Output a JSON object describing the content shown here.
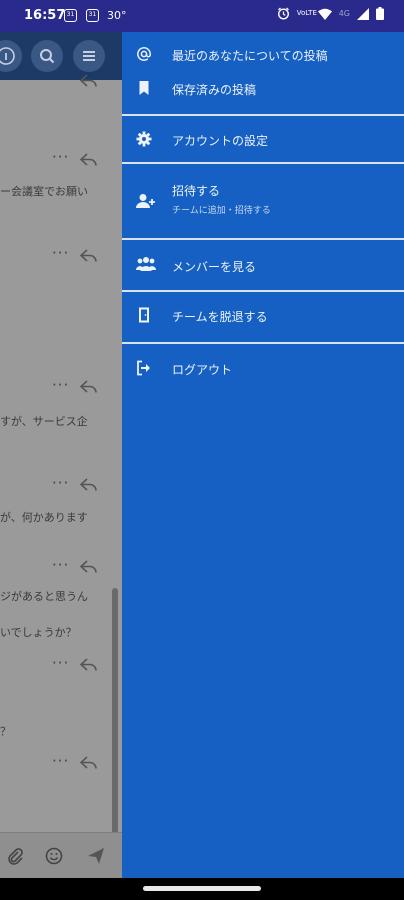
{
  "status_bar": {
    "time": "16:57",
    "temperature": "30°",
    "notification_icons": [
      "calendar-icon",
      "calendar-icon"
    ],
    "volte_label": "VoLTE",
    "network_label": "4G"
  },
  "background_chat": {
    "messages": [
      {
        "text": "ー会議室でお願い"
      },
      {
        "text": "すが、サービス企"
      },
      {
        "text": "が、何かあります"
      },
      {
        "text": "ジがあると思うん"
      },
      {
        "text": "いでしょうか？"
      },
      {
        "text": "？"
      }
    ]
  },
  "drawer": {
    "items": [
      {
        "label": "最近のあなたについての投稿",
        "icon": "at-icon"
      },
      {
        "label": "保存済みの投稿",
        "icon": "bookmark-icon"
      },
      {
        "label": "アカウントの設定",
        "icon": "gear-icon"
      },
      {
        "label": "招待する",
        "sublabel": "チームに追加・招待する",
        "icon": "add-user-icon"
      },
      {
        "label": "メンバーを見る",
        "icon": "members-icon"
      },
      {
        "label": "チームを脱退する",
        "icon": "leave-team-icon"
      },
      {
        "label": "ログアウト",
        "icon": "logout-icon"
      }
    ]
  },
  "colors": {
    "drawer_bg": "#1560c2",
    "status_bar_bg": "#2a2a8c",
    "header_bg": "#1d3a66",
    "divider": "#d6e2f5"
  }
}
